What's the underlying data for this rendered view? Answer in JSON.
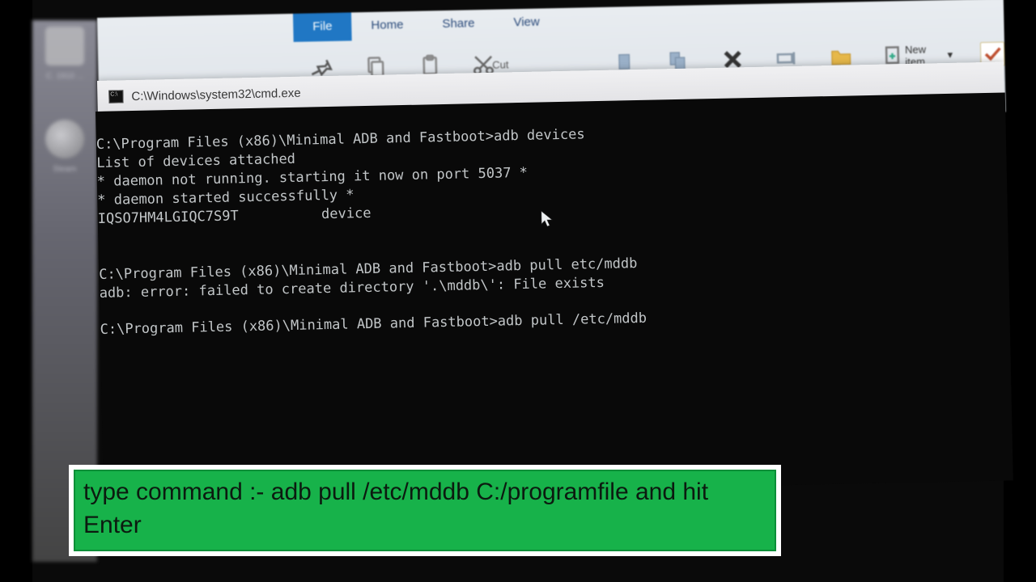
{
  "explorer": {
    "tabs": {
      "file": "File",
      "home": "Home",
      "share": "Share",
      "view": "View"
    },
    "cut": "Cut",
    "newitem": "New item"
  },
  "desktop": {
    "label_steam": "Steam",
    "label_misc": "C. 1910 ..."
  },
  "cmd": {
    "title": "C:\\Windows\\system32\\cmd.exe",
    "lines": [
      "C:\\Program Files (x86)\\Minimal ADB and Fastboot>adb devices",
      "List of devices attached",
      "* daemon not running. starting it now on port 5037 *",
      "* daemon started successfully *",
      "IQSO7HM4LGIQC7S9T          device",
      "",
      "",
      "C:\\Program Files (x86)\\Minimal ADB and Fastboot>adb pull etc/mddb",
      "adb: error: failed to create directory '.\\mddb\\': File exists",
      "",
      "C:\\Program Files (x86)\\Minimal ADB and Fastboot>adb pull /etc/mddb"
    ]
  },
  "instruction": {
    "text": "type command :- adb pull /etc/mddb C:/programfile and hit Enter"
  }
}
